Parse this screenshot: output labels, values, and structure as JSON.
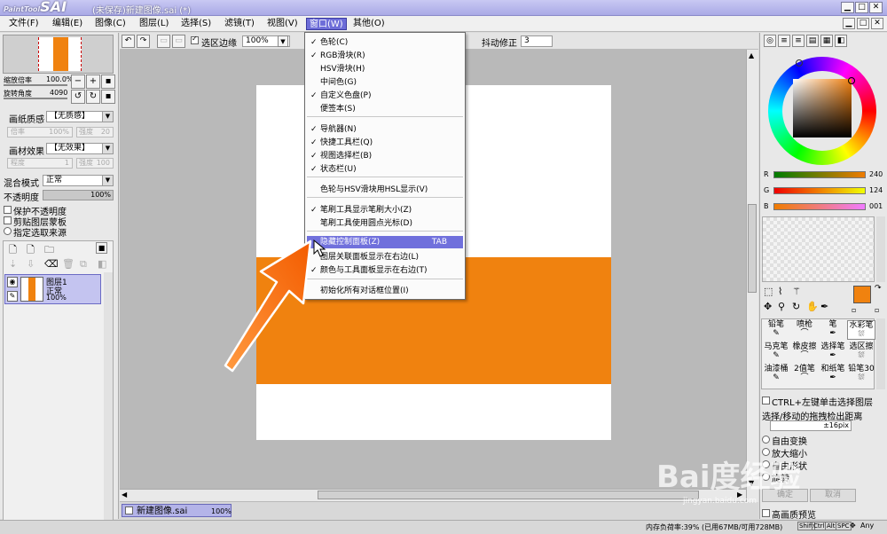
{
  "app": {
    "logo_small": "PaintTool",
    "logo_big": "SAI",
    "title": "(未保存)新建图像.sai (*)"
  },
  "menubar": {
    "items": [
      {
        "label": "文件",
        "key": "(F)"
      },
      {
        "label": "编辑",
        "key": "(E)"
      },
      {
        "label": "图像",
        "key": "(C)"
      },
      {
        "label": "图层",
        "key": "(L)"
      },
      {
        "label": "选择",
        "key": "(S)"
      },
      {
        "label": "滤镜",
        "key": "(T)"
      },
      {
        "label": "视图",
        "key": "(V)"
      },
      {
        "label": "窗口",
        "key": "(W)"
      },
      {
        "label": "其他",
        "key": "(O)"
      }
    ]
  },
  "toolbar": {
    "select_edge": "选区边缘",
    "zoom": "100%",
    "stabilizer_label": "抖动修正",
    "stabilizer_value": "3"
  },
  "navigator": {
    "zoom_label": "缩放倍率",
    "zoom_value": "100.0%",
    "angle_label": "旋转角度",
    "angle_value": "4090"
  },
  "paper": {
    "texture_label": "画纸质感",
    "texture_value": "【无质感】",
    "rate_label": "倍率",
    "rate_value": "100%",
    "strength_label": "强度",
    "strength_value": "20"
  },
  "material": {
    "label": "画材效果",
    "value": "【无效果】",
    "degree_label": "程度",
    "degree_value": "1",
    "strength_label": "强度",
    "strength_value": "100"
  },
  "blend": {
    "label": "混合模式",
    "value": "正常",
    "opacity_label": "不透明度",
    "opacity_value": "100%"
  },
  "options": {
    "protect": "保护不透明度",
    "clip": "剪贴图层蒙板",
    "select_src": "指定选取来源"
  },
  "layer": {
    "name": "图层1",
    "mode": "正常",
    "opacity": "100%"
  },
  "window_menu": {
    "items": [
      {
        "label": "色轮(C)",
        "checked": true
      },
      {
        "label": "RGB滑块(R)",
        "checked": true
      },
      {
        "label": "HSV滑块(H)",
        "checked": false
      },
      {
        "label": "中间色(G)",
        "checked": false
      },
      {
        "label": "自定义色盘(P)",
        "checked": true
      },
      {
        "label": "便签本(S)",
        "checked": false
      },
      {
        "label": "导航器(N)",
        "checked": true
      },
      {
        "label": "快捷工具栏(Q)",
        "checked": true
      },
      {
        "label": "视图选择栏(B)",
        "checked": true
      },
      {
        "label": "状态栏(U)",
        "checked": true
      },
      {
        "label": "色轮与HSV滑块用HSL显示(V)",
        "checked": false
      },
      {
        "label": "笔刷工具显示笔刷大小(Z)",
        "checked": true
      },
      {
        "label": "笔刷工具使用圆点光标(D)",
        "checked": false
      },
      {
        "label": "隐藏控制面板(Z)",
        "checked": false,
        "shortcut": "TAB"
      },
      {
        "label": "图层关联面板显示在右边(L)",
        "checked": false
      },
      {
        "label": "颜色与工具面板显示在右边(T)",
        "checked": true
      },
      {
        "label": "初始化所有对话框位置(I)",
        "checked": false
      }
    ]
  },
  "rgb": {
    "r_label": "R",
    "r_value": "240",
    "g_label": "G",
    "g_value": "124",
    "b_label": "B",
    "b_value": "001"
  },
  "colors": {
    "foreground": "#f0820f",
    "accent": "#6d6dd8",
    "canvas_bg": "#b9b9b9",
    "menu_highlight": "#7070dc"
  },
  "tools": [
    [
      "铅笔",
      "喷枪",
      "笔",
      "水彩笔"
    ],
    [
      "马克笔",
      "橡皮擦",
      "选择笔",
      "选区擦"
    ],
    [
      "油漆桶",
      "2值笔",
      "和纸笔",
      "铅笔30"
    ]
  ],
  "tool_options": {
    "ctrl_click": "CTRL+左键单击选择图层",
    "drag_label": "选择/移动的拖拽检出距离",
    "drag_value": "±16pix",
    "free_transform": "自由变换",
    "scale": "放大缩小",
    "free_shape": "自由形状",
    "rotate": "旋转",
    "ok": "确定",
    "cancel": "取消",
    "hq_preview": "高画质预览"
  },
  "doc_tab": {
    "name": "新建图像.sai",
    "zoom": "100%"
  },
  "status": {
    "memory": "内存负荷率:39% (已用67MB/可用728MB)",
    "keys": [
      "Shift",
      "Ctrl",
      "Alt",
      "SPC"
    ],
    "any": "Any"
  },
  "watermark": {
    "text": "Bai度经验",
    "url": "jingyan.baidu.com"
  }
}
